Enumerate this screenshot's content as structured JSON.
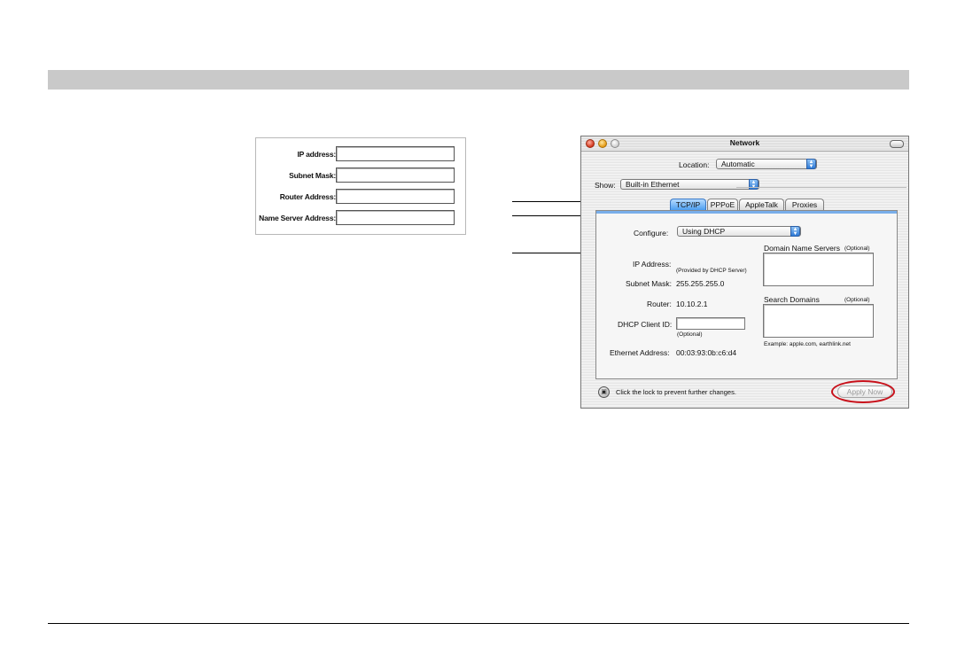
{
  "manual_form": {
    "fields": [
      {
        "label": "IP address:",
        "value": ""
      },
      {
        "label": "Subnet Mask:",
        "value": ""
      },
      {
        "label": "Router Address:",
        "value": ""
      },
      {
        "label": "Name Server Address:",
        "value": ""
      }
    ]
  },
  "network_window": {
    "title": "Network",
    "location_label": "Location:",
    "location_value": "Automatic",
    "show_label": "Show:",
    "show_value": "Built-in Ethernet",
    "tabs": [
      {
        "label": "TCP/IP",
        "active": true
      },
      {
        "label": "PPPoE",
        "active": false
      },
      {
        "label": "AppleTalk",
        "active": false
      },
      {
        "label": "Proxies",
        "active": false
      }
    ],
    "configure_label": "Configure:",
    "configure_value": "Using DHCP",
    "ip_address_label": "IP Address:",
    "ip_address_note": "(Provided by DHCP Server)",
    "subnet_mask_label": "Subnet Mask:",
    "subnet_mask_value": "255.255.255.0",
    "router_label": "Router:",
    "router_value": "10.10.2.1",
    "dhcp_client_id_label": "DHCP Client ID:",
    "dhcp_client_id_value": "",
    "dhcp_client_id_note": "(Optional)",
    "ethernet_address_label": "Ethernet Address:",
    "ethernet_address_value": "00:03:93:0b:c6:d4",
    "dns_label": "Domain Name Servers",
    "dns_optional": "(Optional)",
    "search_domains_label": "Search Domains",
    "search_domains_optional": "(Optional)",
    "example_text": "Example: apple.com, earthlink.net",
    "lock_text": "Click the lock to prevent further changes.",
    "apply_button": "Apply Now",
    "highlight_color": "#c8101a",
    "active_tab_color": "#4c9ef0"
  }
}
